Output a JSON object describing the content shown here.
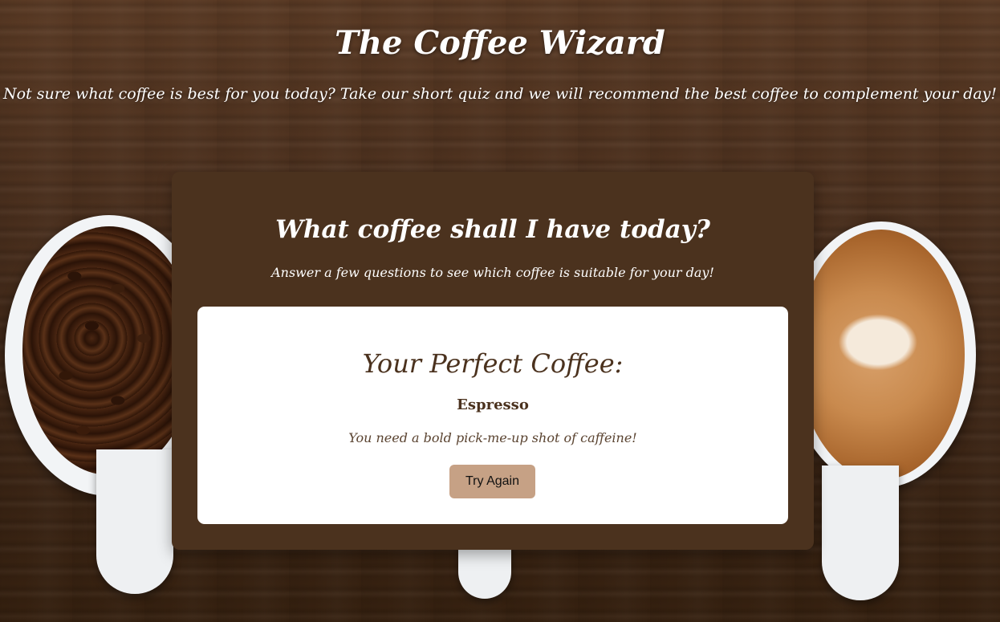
{
  "header": {
    "title": "The Coffee Wizard",
    "tagline": "Not sure what coffee is best for you today? Take our short quiz and we will recommend the best coffee to complement your day!"
  },
  "quiz": {
    "heading": "What coffee shall I have today?",
    "subheading": "Answer a few questions to see which coffee is suitable for your day!",
    "result": {
      "heading": "Your Perfect Coffee:",
      "coffee_name": "Espresso",
      "description": "You need a bold pick-me-up shot of caffeine!",
      "try_again_label": "Try Again"
    }
  },
  "colors": {
    "panel_bg": "#4b321e",
    "card_bg": "#ffffff",
    "button_bg": "#c6a185",
    "title_text": "#ffffff"
  },
  "background": {
    "image": "coffee-cups-on-wooden-table",
    "icons": [
      "coffee-beans-cup",
      "latte-cup"
    ]
  }
}
